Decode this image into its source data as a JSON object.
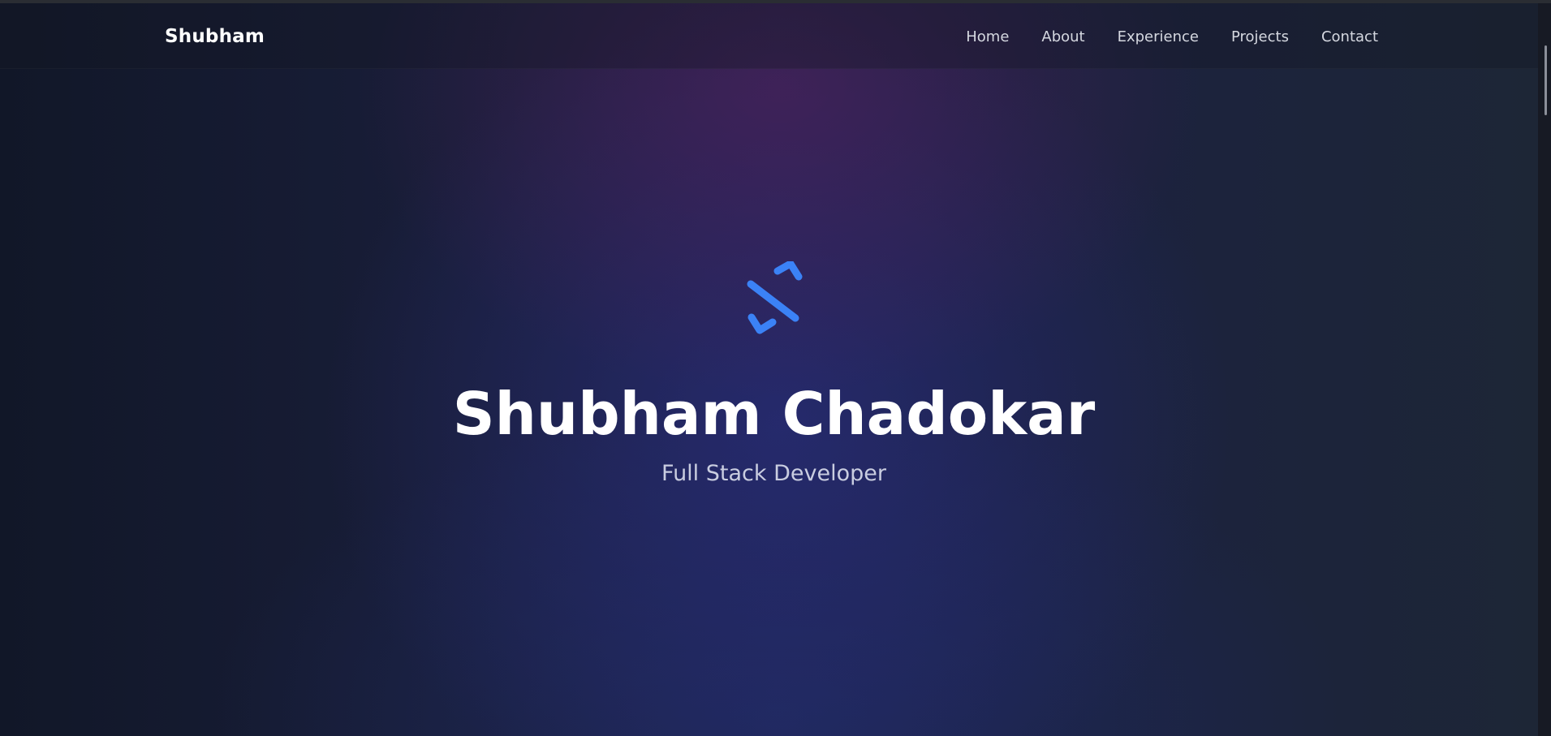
{
  "navbar": {
    "brand": "Shubham",
    "links": [
      {
        "label": "Home"
      },
      {
        "label": "About"
      },
      {
        "label": "Experience"
      },
      {
        "label": "Projects"
      },
      {
        "label": "Contact"
      }
    ]
  },
  "hero": {
    "logo_icon": "code-brackets-icon",
    "name": "Shubham Chadokar",
    "subtitle": "Full Stack Developer"
  },
  "colors": {
    "accent": "#3b82f6",
    "background": "#1b1f3a",
    "text": "#ffffff"
  }
}
